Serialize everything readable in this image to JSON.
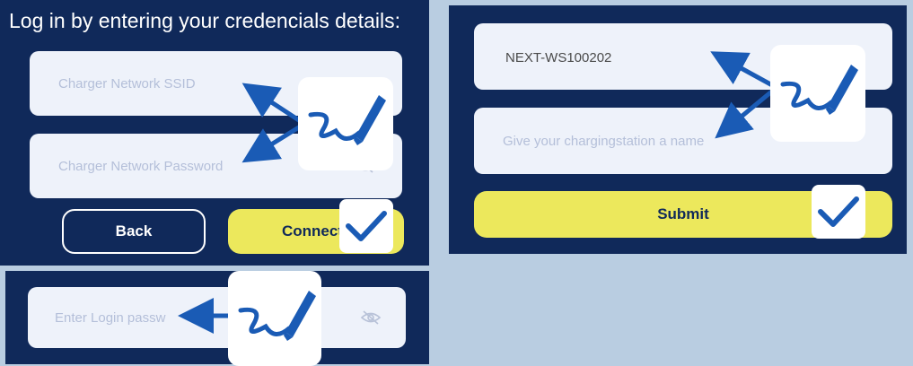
{
  "login_panel": {
    "heading": "Log in by entering your credencials details:",
    "ssid_field": {
      "placeholder": "Charger Network SSID"
    },
    "password_field": {
      "placeholder": "Charger Network Password"
    },
    "back_button": "Back",
    "connect_button": "Connect"
  },
  "name_panel": {
    "ssid_value": "NEXT-WS100202",
    "name_field": {
      "placeholder": "Give your chargingstation a name"
    },
    "submit_button": "Submit"
  },
  "login_password_panel": {
    "password_field": {
      "placeholder": "Enter Login passw"
    }
  },
  "colors": {
    "panel_background": "#10295a",
    "page_background": "#b9cde1",
    "field_background": "#eef2fa",
    "accent_yellow": "#ece85c",
    "annotation_blue": "#1a5bb5"
  },
  "icons": [
    "pen-scribble-icon",
    "checkmark-icon",
    "eye-off-icon",
    "arrow-icon"
  ]
}
